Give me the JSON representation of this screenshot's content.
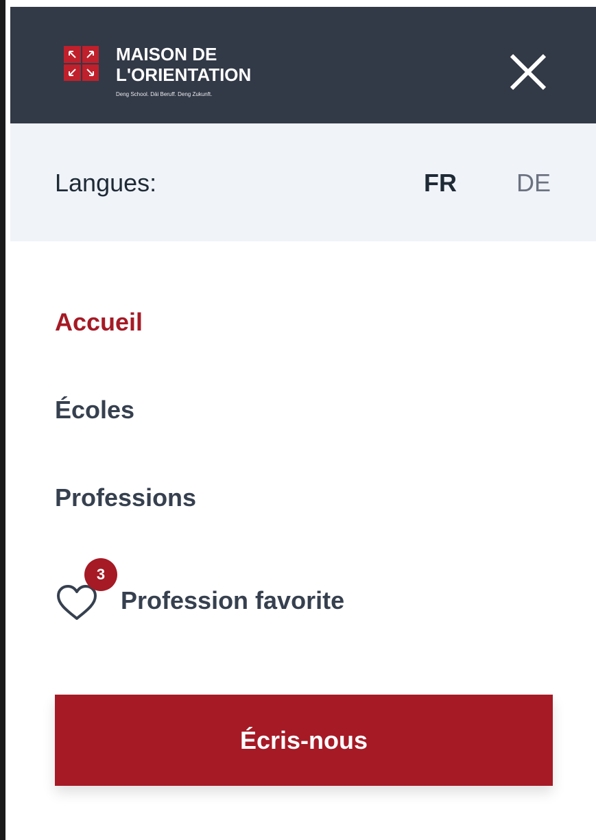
{
  "header": {
    "logo": {
      "line1": "MAISON DE",
      "line2": "L'ORIENTATION",
      "tagline": "Deng School. Däi Beruff. Deng Zukunft."
    },
    "close_icon": "close-icon"
  },
  "languages": {
    "label": "Langues:",
    "options": [
      {
        "code": "FR",
        "selected": true
      },
      {
        "code": "DE",
        "selected": false
      }
    ]
  },
  "nav": {
    "items": [
      {
        "label": "Accueil",
        "active": true
      },
      {
        "label": "Écoles",
        "active": false
      },
      {
        "label": "Professions",
        "active": false
      }
    ],
    "favorite": {
      "label": "Profession favorite",
      "count": "3",
      "icon": "heart-icon"
    }
  },
  "cta": {
    "label": "Écris-nous"
  },
  "colors": {
    "header_bg": "#323947",
    "lang_bar_bg": "#f0f3f8",
    "accent": "#a51a25",
    "nav_text": "#36404f"
  }
}
